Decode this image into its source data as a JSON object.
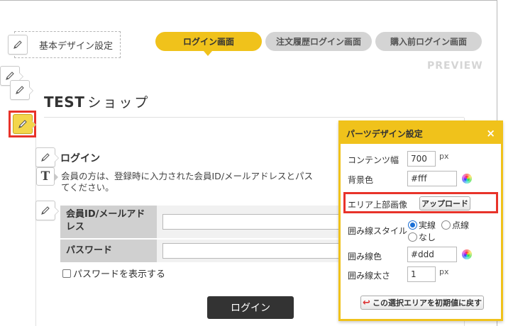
{
  "colors": {
    "accent": "#f0c21b",
    "highlight_red": "#e8332a",
    "button_dark": "#333333"
  },
  "basic_design": {
    "label": "基本デザイン設定",
    "icon": "pencil-icon"
  },
  "tabs": [
    {
      "label": "ログイン画面",
      "active": true
    },
    {
      "label": "注文履歴ログイン画面",
      "active": false
    },
    {
      "label": "購入前ログイン画面",
      "active": false
    }
  ],
  "preview_label": "PREVIEW",
  "shop": {
    "title_latin": "TEST",
    "title_kana": "ショップ"
  },
  "login": {
    "heading": "ログイン",
    "description_line1": "会員の方は、登録時に入力された会員ID/メールアドレスとパス",
    "description_line2": "てください。",
    "id_label": "会員ID/メールアドレス",
    "password_label": "パスワード",
    "show_password": "パスワードを表示する",
    "submit": "ログイン"
  },
  "panel": {
    "title": "パーツデザイン設定",
    "close": "×",
    "content_width_label": "コンテンツ幅",
    "content_width_value": "700",
    "content_width_unit": "px",
    "bg_color_label": "背景色",
    "bg_color_value": "#fff",
    "area_top_image_label": "エリア上部画像",
    "upload_button": "アップロード",
    "border_style_label": "囲み線スタイル",
    "border_style_options": [
      "実線",
      "点線",
      "なし"
    ],
    "border_style_selected": "実線",
    "border_color_label": "囲み線色",
    "border_color_value": "#ddd",
    "border_width_label": "囲み線太さ",
    "border_width_value": "1",
    "border_width_unit": "px",
    "reset_button": "この選択エリアを初期値に戻す"
  }
}
